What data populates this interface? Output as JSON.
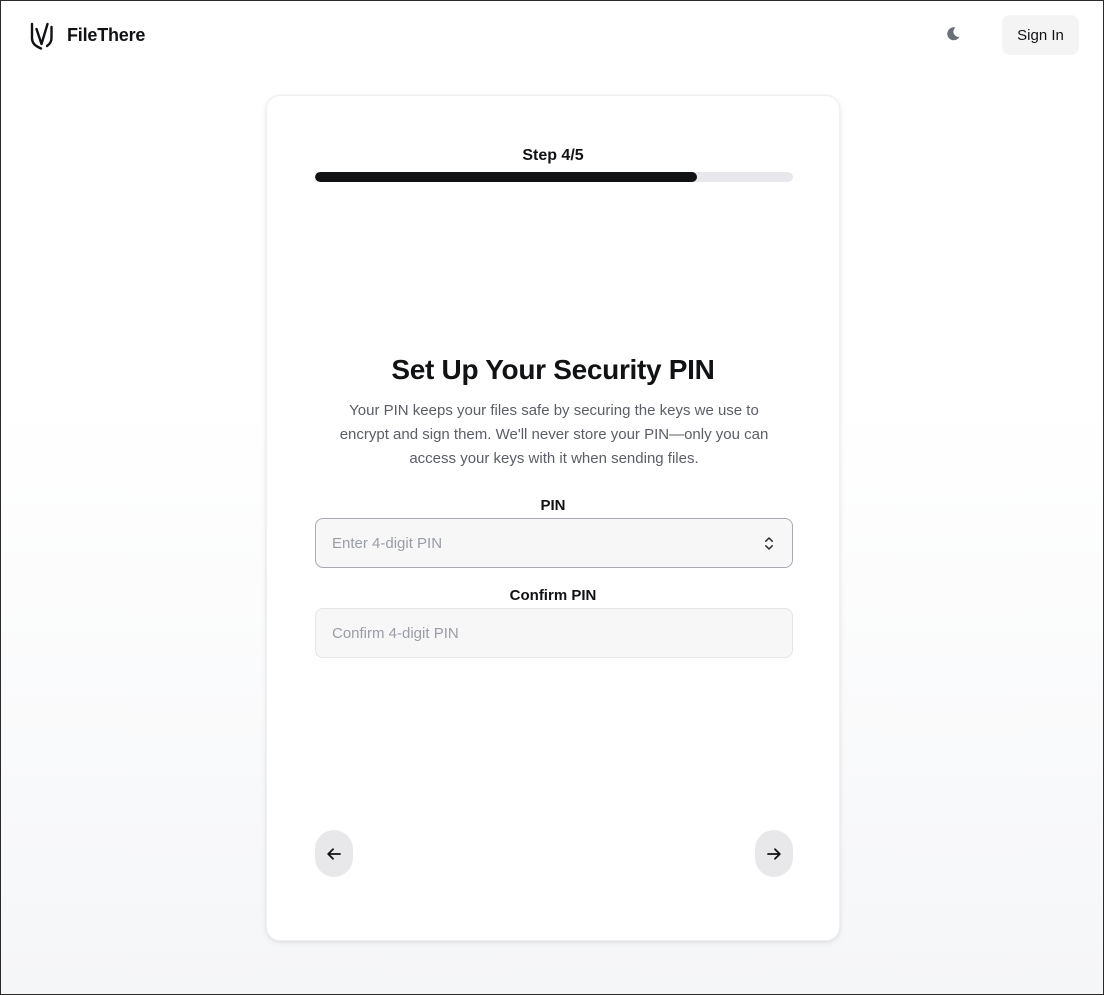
{
  "header": {
    "brand_name": "FileThere",
    "logo_icon": "shield-v-logo",
    "theme_icon": "moon-icon",
    "signin_label": "Sign In"
  },
  "card": {
    "step_label": "Step 4/5",
    "progress": {
      "current": 4,
      "total": 5,
      "fraction": 0.8
    },
    "title": "Set Up Your Security PIN",
    "description": "Your PIN keeps your files safe by securing the keys we use to encrypt and sign them. We'll never store your PIN—only you can access your keys with it when sending files.",
    "pin": {
      "label": "PIN",
      "placeholder": "Enter 4-digit PIN",
      "value": ""
    },
    "confirm_pin": {
      "label": "Confirm PIN",
      "placeholder": "Confirm 4-digit PIN",
      "value": ""
    },
    "back_icon": "arrow-left-icon",
    "next_icon": "arrow-right-icon"
  },
  "colors": {
    "accent": "#111214",
    "muted_text": "#5b5e66",
    "track": "#e8e8ec",
    "nav_button": "#e8e8eb"
  }
}
